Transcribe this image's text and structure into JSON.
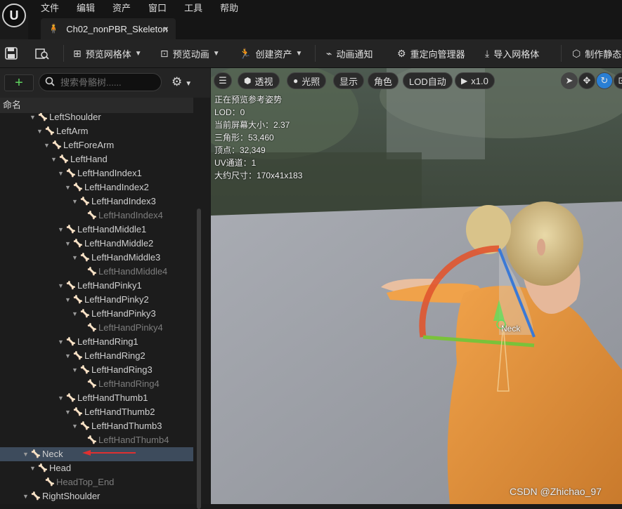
{
  "menu": {
    "items": [
      "文件",
      "编辑",
      "资产",
      "窗口",
      "工具",
      "帮助"
    ]
  },
  "tab": {
    "title": "Ch02_nonPBR_Skeleton",
    "close": "×"
  },
  "toolbar": {
    "preview_mesh": "预览网格体",
    "preview_anim": "预览动画",
    "create_asset": "创建资产",
    "anim_notify": "动画通知",
    "retarget_manager": "重定向管理器",
    "import_mesh": "导入网格体",
    "make_static": "制作静态"
  },
  "skeleton_panel": {
    "add_label": "+",
    "search_placeholder": "搜索骨骼树......",
    "column_name": "命名",
    "bones": [
      {
        "name": "LeftShoulder",
        "depth": 0,
        "leaf": false,
        "selected": false
      },
      {
        "name": "LeftArm",
        "depth": 1,
        "leaf": false,
        "selected": false
      },
      {
        "name": "LeftForeArm",
        "depth": 2,
        "leaf": false,
        "selected": false
      },
      {
        "name": "LeftHand",
        "depth": 3,
        "leaf": false,
        "selected": false
      },
      {
        "name": "LeftHandIndex1",
        "depth": 4,
        "leaf": false,
        "selected": false
      },
      {
        "name": "LeftHandIndex2",
        "depth": 5,
        "leaf": false,
        "selected": false
      },
      {
        "name": "LeftHandIndex3",
        "depth": 6,
        "leaf": false,
        "selected": false
      },
      {
        "name": "LeftHandIndex4",
        "depth": 7,
        "leaf": true,
        "selected": false
      },
      {
        "name": "LeftHandMiddle1",
        "depth": 4,
        "leaf": false,
        "selected": false
      },
      {
        "name": "LeftHandMiddle2",
        "depth": 5,
        "leaf": false,
        "selected": false
      },
      {
        "name": "LeftHandMiddle3",
        "depth": 6,
        "leaf": false,
        "selected": false
      },
      {
        "name": "LeftHandMiddle4",
        "depth": 7,
        "leaf": true,
        "selected": false
      },
      {
        "name": "LeftHandPinky1",
        "depth": 4,
        "leaf": false,
        "selected": false
      },
      {
        "name": "LeftHandPinky2",
        "depth": 5,
        "leaf": false,
        "selected": false
      },
      {
        "name": "LeftHandPinky3",
        "depth": 6,
        "leaf": false,
        "selected": false
      },
      {
        "name": "LeftHandPinky4",
        "depth": 7,
        "leaf": true,
        "selected": false
      },
      {
        "name": "LeftHandRing1",
        "depth": 4,
        "leaf": false,
        "selected": false
      },
      {
        "name": "LeftHandRing2",
        "depth": 5,
        "leaf": false,
        "selected": false
      },
      {
        "name": "LeftHandRing3",
        "depth": 6,
        "leaf": false,
        "selected": false
      },
      {
        "name": "LeftHandRing4",
        "depth": 7,
        "leaf": true,
        "selected": false
      },
      {
        "name": "LeftHandThumb1",
        "depth": 4,
        "leaf": false,
        "selected": false
      },
      {
        "name": "LeftHandThumb2",
        "depth": 5,
        "leaf": false,
        "selected": false
      },
      {
        "name": "LeftHandThumb3",
        "depth": 6,
        "leaf": false,
        "selected": false
      },
      {
        "name": "LeftHandThumb4",
        "depth": 7,
        "leaf": true,
        "selected": false
      },
      {
        "name": "Neck",
        "depth": -1,
        "leaf": false,
        "selected": true
      },
      {
        "name": "Head",
        "depth": 0,
        "leaf": false,
        "selected": false
      },
      {
        "name": "HeadTop_End",
        "depth": 1,
        "leaf": true,
        "selected": false
      },
      {
        "name": "RightShoulder",
        "depth": -1,
        "leaf": false,
        "selected": false
      }
    ]
  },
  "viewport": {
    "buttons": {
      "perspective": "透视",
      "lit": "光照",
      "show": "显示",
      "character": "角色",
      "lod": "LOD自动",
      "speed": "x1.0"
    },
    "stats": [
      "正在预览参考姿势",
      "LOD：0",
      "当前屏幕大小：2.37",
      "三角形：53,460",
      "顶点：32,349",
      "UV通道：1",
      "大约尺寸：170x41x183"
    ],
    "selected_bone_label": "Neck",
    "watermark": "CSDN @Zhichao_97"
  },
  "colors": {
    "selection": "#3d4b5c",
    "accent_blue": "#2a7fd4",
    "add_green": "#5fd35f"
  }
}
